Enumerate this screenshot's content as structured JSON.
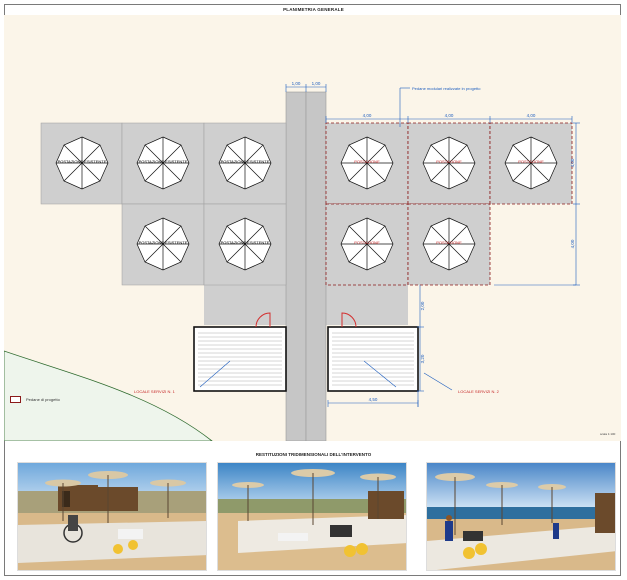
{
  "plan": {
    "title": "PLANIMETRIA GENERALE",
    "label_existing": "POSTAZIONE ESISTENTE",
    "label_project": "POSTAZIONE",
    "annotation_project": "Pedane modulari realizzate in progetto",
    "service_1": "LOCALE SERVIZI N. 1",
    "service_2": "LOCALE SERVIZI N. 2",
    "dim_walkway_a": "1,00",
    "dim_walkway_b": "1,00",
    "dim_module_1": "4,00",
    "dim_module_2": "4,00",
    "dim_module_3": "4,00",
    "dim_right_1": "4,00",
    "dim_right_2": "4,00",
    "dim_vertical_1": "2,00",
    "dim_vertical_2": "3,20",
    "dim_bottom": "4,50",
    "legend_label": "Pedane di progetto",
    "stamp": "scala 1:100"
  },
  "photos": {
    "title": "RESTITUZIONI TRIDIMENSIONALI DELL'INTERVENTO",
    "items": [
      {
        "name": "render-1"
      },
      {
        "name": "render-2"
      },
      {
        "name": "render-3"
      }
    ]
  },
  "colors": {
    "background": "#fbf5e9",
    "module": "#cfcfcf",
    "walkway": "#c6c6c6",
    "project_outline": "#8b1a1a",
    "dimension": "#1f5fbf",
    "door": "#d32f2f",
    "green_area": "#eef5ec"
  }
}
